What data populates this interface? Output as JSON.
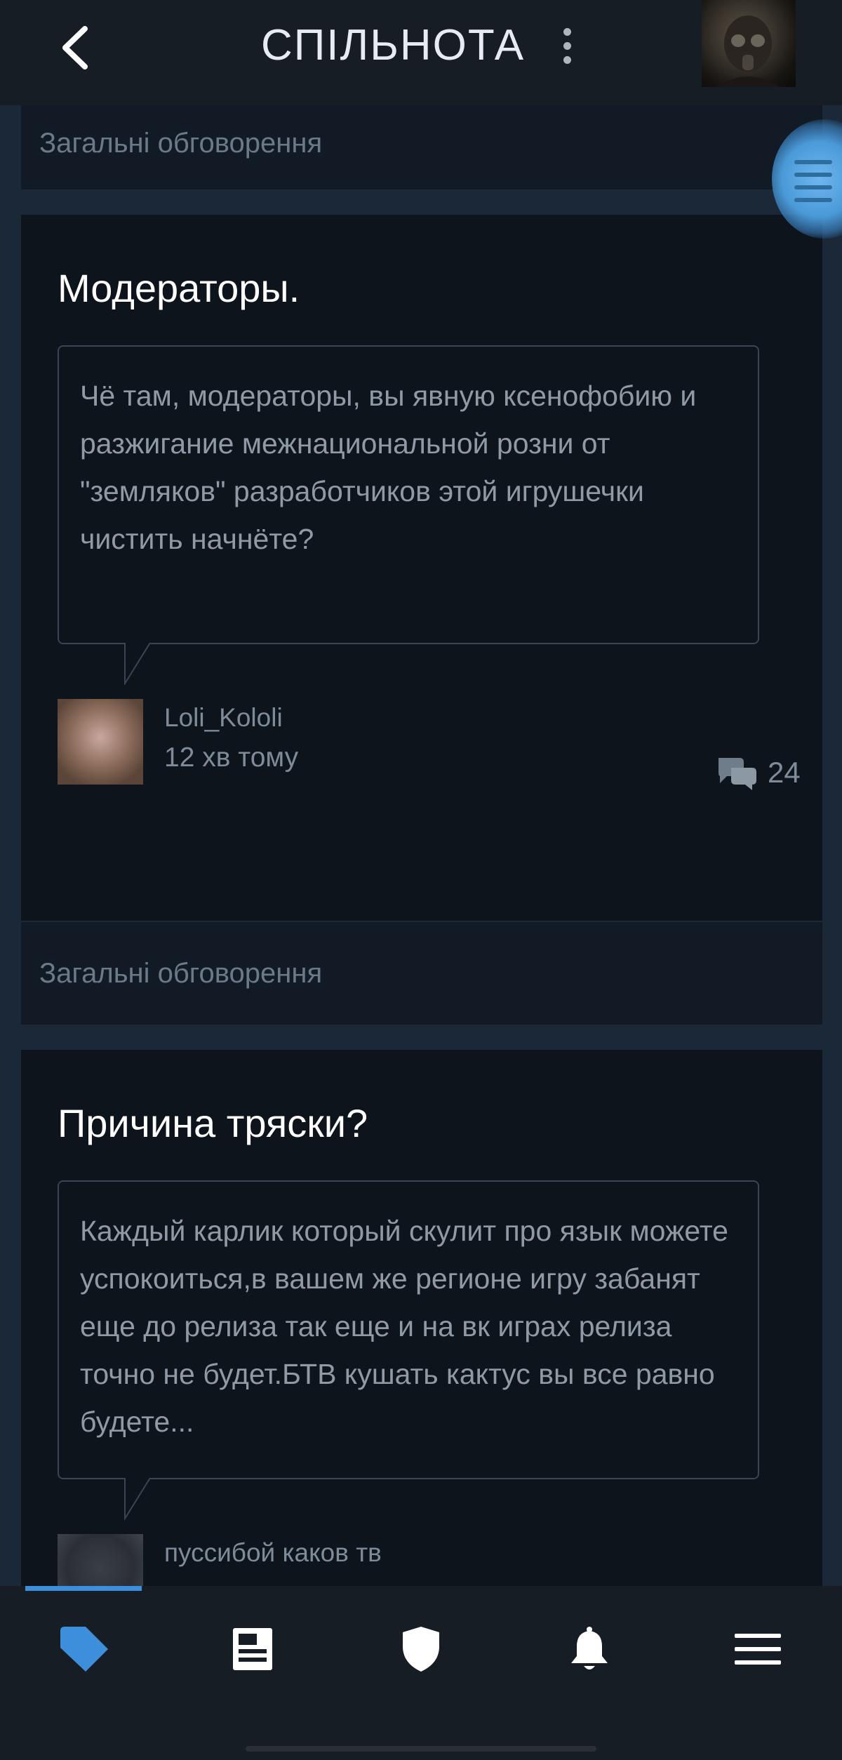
{
  "header": {
    "title": "СПІЛЬНОТА"
  },
  "posts": [
    {
      "category": "Загальні обговорення",
      "title": "Модераторы.",
      "body": "Чё там, модераторы, вы явную ксенофобию и разжигание межнациональной розни от \"земляков\" разработчиков этой игрушечки чистить начнёте?",
      "author": "Loli_Kololi",
      "time": "12 хв тому",
      "comments": "24"
    },
    {
      "category": "Загальні обговорення",
      "title": "Причина тряски?",
      "body": "Каждый карлик который скулит про язык можете успокоиться,в вашем же регионе игру забанят еще до релиза так еще и на вк играх релиза точно не будет.БТВ кушать кактус вы все равно будете...",
      "author": "пуссибой каков тв"
    }
  ],
  "nav": {
    "items": [
      "tag-icon",
      "news-icon",
      "shield-icon",
      "bell-icon",
      "menu-icon"
    ],
    "active_color": "#3d8fdc"
  },
  "colors": {
    "background": "#1b2838",
    "card": "#0e141c",
    "accent": "#3d8fdc"
  }
}
